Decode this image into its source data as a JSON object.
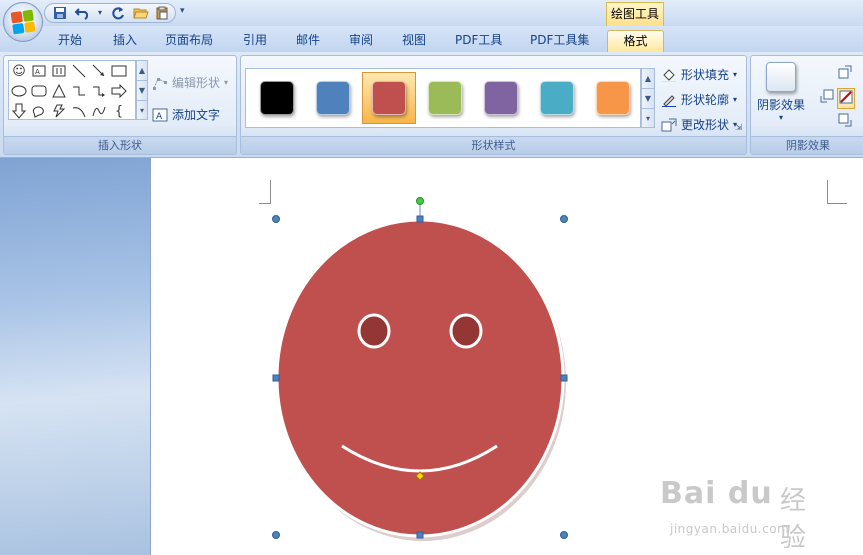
{
  "quick_access": {
    "save_icon": "save-icon",
    "undo_icon": "undo-icon",
    "redo_icon": "redo-icon",
    "open_icon": "open-folder-icon",
    "paste_icon": "paste-icon",
    "more": "▾"
  },
  "context_tab_title": "绘图工具",
  "tabs": [
    {
      "label": "开始"
    },
    {
      "label": "插入"
    },
    {
      "label": "页面布局"
    },
    {
      "label": "引用"
    },
    {
      "label": "邮件"
    },
    {
      "label": "审阅"
    },
    {
      "label": "视图"
    },
    {
      "label": "PDF工具"
    },
    {
      "label": "PDF工具集"
    },
    {
      "label": "格式",
      "active": true
    }
  ],
  "ribbon": {
    "insert_shapes": {
      "label": "插入形状",
      "edit_shape": "编辑形状",
      "add_text": "添加文字"
    },
    "shape_styles": {
      "label": "形状样式",
      "swatches": [
        "#000000",
        "#4f81bd",
        "#c0504d",
        "#9bbb59",
        "#8064a2",
        "#4bacc6",
        "#f79646"
      ],
      "selected_index": 2,
      "fill": "形状填充",
      "outline": "形状轮廓",
      "change": "更改形状"
    },
    "shadow_effects": {
      "label": "阴影效果",
      "button": "阴影效果"
    }
  },
  "shape": {
    "fill_color": "#c0504d",
    "eye_color": "#943634",
    "stroke_color": "#ffffff"
  },
  "watermark": {
    "logo": "Bai du",
    "text": "经验",
    "url": "jingyan.baidu.com"
  }
}
